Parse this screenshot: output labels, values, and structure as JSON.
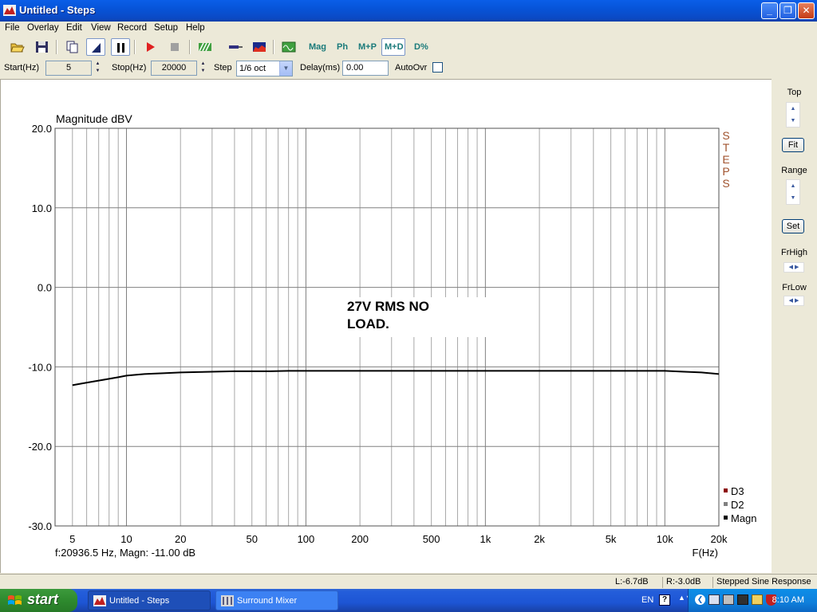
{
  "window": {
    "title": "Untitled - Steps"
  },
  "menu": [
    "File",
    "Overlay",
    "Edit",
    "View",
    "Record",
    "Setup",
    "Help"
  ],
  "toolbar": {
    "mag": "Mag",
    "ph": "Ph",
    "mp": "M+P",
    "md": "M+D",
    "dpct": "D%"
  },
  "params": {
    "start_label": "Start(Hz)",
    "start_value": "5",
    "stop_label": "Stop(Hz)",
    "stop_value": "20000",
    "step_label": "Step",
    "step_value": "1/6 oct",
    "delay_label": "Delay(ms)",
    "delay_value": "0.00",
    "autoovr_label": "AutoOvr"
  },
  "side": {
    "top": "Top",
    "fit": "Fit",
    "range": "Range",
    "set": "Set",
    "frhigh": "FrHigh",
    "frlow": "FrLow"
  },
  "chart_data": {
    "type": "line",
    "ylabel": "Magnitude dBV",
    "xlabel": "F(Hz)",
    "x_scale": "log",
    "xlim": [
      4,
      20000
    ],
    "ylim": [
      -30,
      20
    ],
    "yticks": [
      20,
      10,
      0,
      -10,
      -20,
      -30
    ],
    "ytick_labels": [
      "20.0",
      "10.0",
      "0.0",
      "-10.0",
      "-20.0",
      "-30.0"
    ],
    "xticks": [
      5,
      10,
      20,
      50,
      100,
      200,
      500,
      1000,
      2000,
      5000,
      10000,
      20000
    ],
    "xtick_labels": [
      "5",
      "10",
      "20",
      "50",
      "100",
      "200",
      "500",
      "1k",
      "2k",
      "5k",
      "10k",
      "20k"
    ],
    "grid": true,
    "annotation": [
      "27V RMS NO",
      "LOAD."
    ],
    "side_text": "STEPS",
    "readout": "f:20936.5 Hz, Magn: -11.00 dB",
    "legend": [
      {
        "name": "D3",
        "color": "#8b0000"
      },
      {
        "name": "D2",
        "color": "#808080"
      },
      {
        "name": "Magn",
        "color": "#000000"
      }
    ],
    "legend_position": "bottom-right",
    "series": [
      {
        "name": "Magn",
        "color": "#000000",
        "x": [
          5,
          5.6,
          6.3,
          7.1,
          8,
          9,
          10,
          11.2,
          12.6,
          14.1,
          16,
          20,
          25,
          31.5,
          40,
          50,
          63,
          80,
          100,
          200,
          500,
          1000,
          2000,
          5000,
          8000,
          10000,
          12500,
          16000,
          20000
        ],
        "y": [
          -12.3,
          -12.1,
          -11.9,
          -11.7,
          -11.5,
          -11.3,
          -11.1,
          -11.0,
          -10.9,
          -10.85,
          -10.8,
          -10.7,
          -10.65,
          -10.6,
          -10.55,
          -10.55,
          -10.55,
          -10.5,
          -10.5,
          -10.5,
          -10.5,
          -10.5,
          -10.5,
          -10.5,
          -10.5,
          -10.5,
          -10.6,
          -10.7,
          -10.9
        ]
      }
    ]
  },
  "status": {
    "l": "L:-6.7dB",
    "r": "R:-3.0dB",
    "mode": "Stepped Sine Response"
  },
  "taskbar": {
    "start": "start",
    "task1": "Untitled - Steps",
    "task2": "Surround Mixer",
    "lang": "EN",
    "clock": "8:10 AM"
  },
  "colors": {
    "titlebar": "#0754d8",
    "taskbar": "#245edb",
    "start": "#2e8a2e",
    "sidetext": "#a0522d",
    "grid": "#808080"
  }
}
